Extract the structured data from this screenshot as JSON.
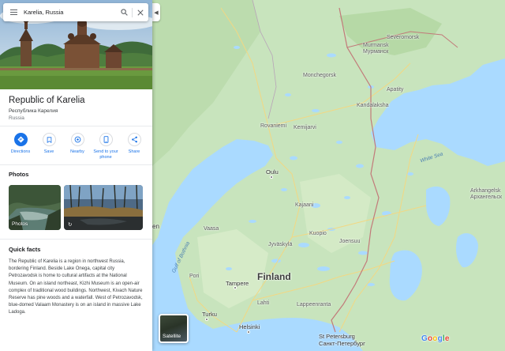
{
  "search": {
    "value": "Karelia, Russia"
  },
  "place": {
    "title": "Republic of Karelia",
    "native_name": "Республика Карелия",
    "country": "Russia"
  },
  "actions": [
    {
      "label": "Directions",
      "icon": "directions-icon"
    },
    {
      "label": "Save",
      "icon": "bookmark-icon"
    },
    {
      "label": "Nearby",
      "icon": "nearby-icon"
    },
    {
      "label": "Send to your phone",
      "icon": "phone-icon"
    },
    {
      "label": "Share",
      "icon": "share-icon"
    }
  ],
  "photos": {
    "heading": "Photos",
    "items": [
      {
        "caption": "Photos"
      },
      {
        "caption": ""
      }
    ]
  },
  "quick_facts": {
    "heading": "Quick facts",
    "text": "The Republic of Karelia is a region in northwest Russia, bordering Finland. Beside Lake Onega, capital city Petrozavodsk is home to cultural artifacts at the National Museum. On an island northeast, Kizhi Museum is an open-air complex of traditional wood buildings. Northwest, Kivach Nature Reserve has pine woods and a waterfall. West of Petrozavodsk, blue-domed Valaam Monastery is on an island in massive Lake Ladoga."
  },
  "map": {
    "labels": {
      "country": "Finland",
      "oulu": "Oulu",
      "tampere": "Tampere",
      "turku": "Turku",
      "helsinki": "Helsinki",
      "st_petersburg": "St Petersburg",
      "st_petersburg_ru": "Санкт-Петербург",
      "white_sea": "White Sea",
      "gulf_bothnia": "Gulf of Bothnia",
      "murmansk": "Murmansk",
      "murmansk_ru": "Мурманск",
      "severomorsk": "Severomorsk",
      "apatity": "Apatity",
      "kandalaksha": "Kandalaksha",
      "arkhangelsk": "Arkhangelsk",
      "arkhangelsk_ru": "Архангельск",
      "monchegorsk": "Monchegorsk",
      "kemijarvi": "Kemijarvi",
      "rovaniemi": "Rovaniemi",
      "kuopio": "Kuopio",
      "joensuu": "Joensuu",
      "jyvaskyla": "Jyväskylä",
      "lahti": "Lahti",
      "lappeenranta": "Lappeenranta",
      "pori": "Pori",
      "vaasa": "Vaasa",
      "kajaani": "Kajaani",
      "edge_left": "en"
    },
    "satellite_label": "Satellite",
    "colors": {
      "land": "#c6e3bb",
      "land_light": "#d8ecca",
      "water": "#aadaff",
      "road": "#f7e9a8",
      "border": "#c27a7a"
    }
  },
  "branding": {
    "logo_letters": [
      "G",
      "o",
      "o",
      "g",
      "l",
      "e"
    ]
  }
}
